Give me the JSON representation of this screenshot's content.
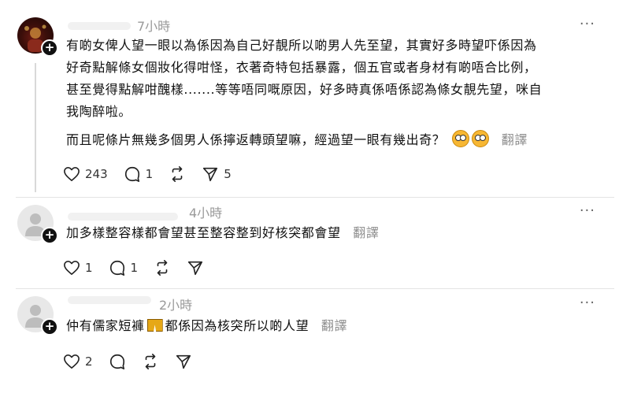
{
  "posts": [
    {
      "time": "7小時",
      "lines": [
        "有啲女俾人望一眼以為係因為自己好靚所以啲男人先至望，其實好多時望吓係因為",
        "好奇點解條女個妝化得咁怪，衣著奇特包括暴露，個五官或者身材有啲唔合比例，",
        "甚至覺得點解咁醜樣.......等等唔同嘅原因，好多時真係唔係認為條女靚先望，咪自",
        "我陶醉啦。"
      ],
      "second_para": "而且呢條片無幾多個男人係擰返轉頭望嘛，經過望一眼有幾出奇？",
      "emoji": "astonished-face-emoji",
      "translate": "翻譯",
      "likes": "243",
      "comments": "1",
      "reposts": "",
      "shares": "5"
    },
    {
      "time": "4小時",
      "text": "加多樣整容樣都會望甚至整容整到好核突都會望",
      "translate": "翻譯",
      "likes": "1",
      "comments": "1",
      "reposts": "",
      "shares": ""
    },
    {
      "time": "2小時",
      "text_before": "仲有儒家短褲",
      "emoji": "shorts-emoji",
      "text_after": "都係因為核突所以啲人望",
      "translate": "翻譯",
      "likes": "2",
      "comments": "",
      "reposts": "",
      "shares": ""
    }
  ],
  "icons": {
    "like": "heart-icon",
    "comment": "comment-icon",
    "repost": "repost-icon",
    "share": "share-icon",
    "more": "more-icon",
    "follow": "follow-plus-icon"
  },
  "more_label": "···",
  "follow_label": "+"
}
